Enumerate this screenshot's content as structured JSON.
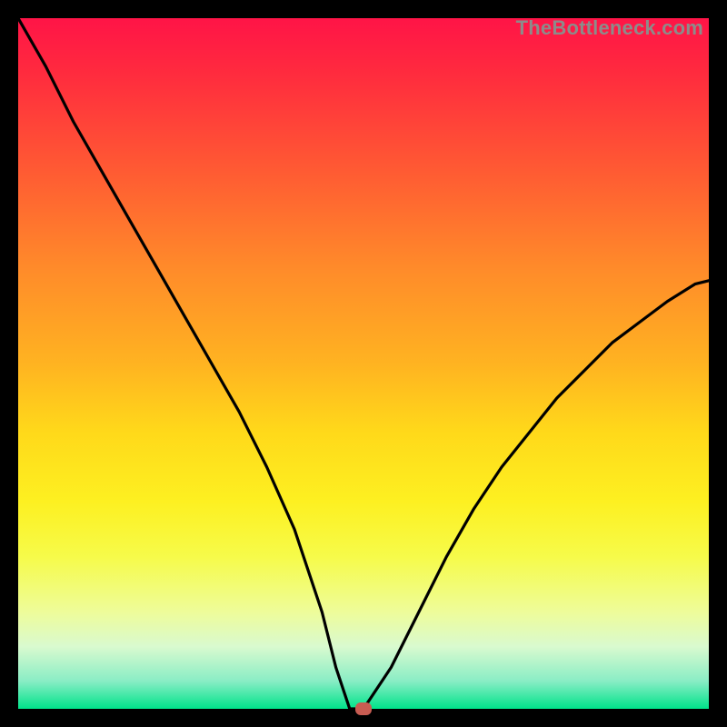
{
  "watermark": "TheBottleneck.com",
  "colors": {
    "frame": "#000000",
    "curve": "#000000",
    "marker": "#c85c52"
  },
  "chart_data": {
    "type": "line",
    "title": "",
    "xlabel": "",
    "ylabel": "",
    "xlim": [
      0,
      100
    ],
    "ylim": [
      0,
      100
    ],
    "grid": false,
    "legend": false,
    "x": [
      0,
      4,
      8,
      12,
      16,
      20,
      24,
      28,
      32,
      36,
      40,
      44,
      46,
      48,
      50,
      54,
      58,
      62,
      66,
      70,
      74,
      78,
      82,
      86,
      90,
      94,
      98,
      100
    ],
    "values": [
      100,
      93,
      85,
      78,
      71,
      64,
      57,
      50,
      43,
      35,
      26,
      14,
      6,
      0,
      0,
      6,
      14,
      22,
      29,
      35,
      40,
      45,
      49,
      53,
      56,
      59,
      61.5,
      62
    ],
    "marker": {
      "x": 50,
      "y": 0
    }
  }
}
